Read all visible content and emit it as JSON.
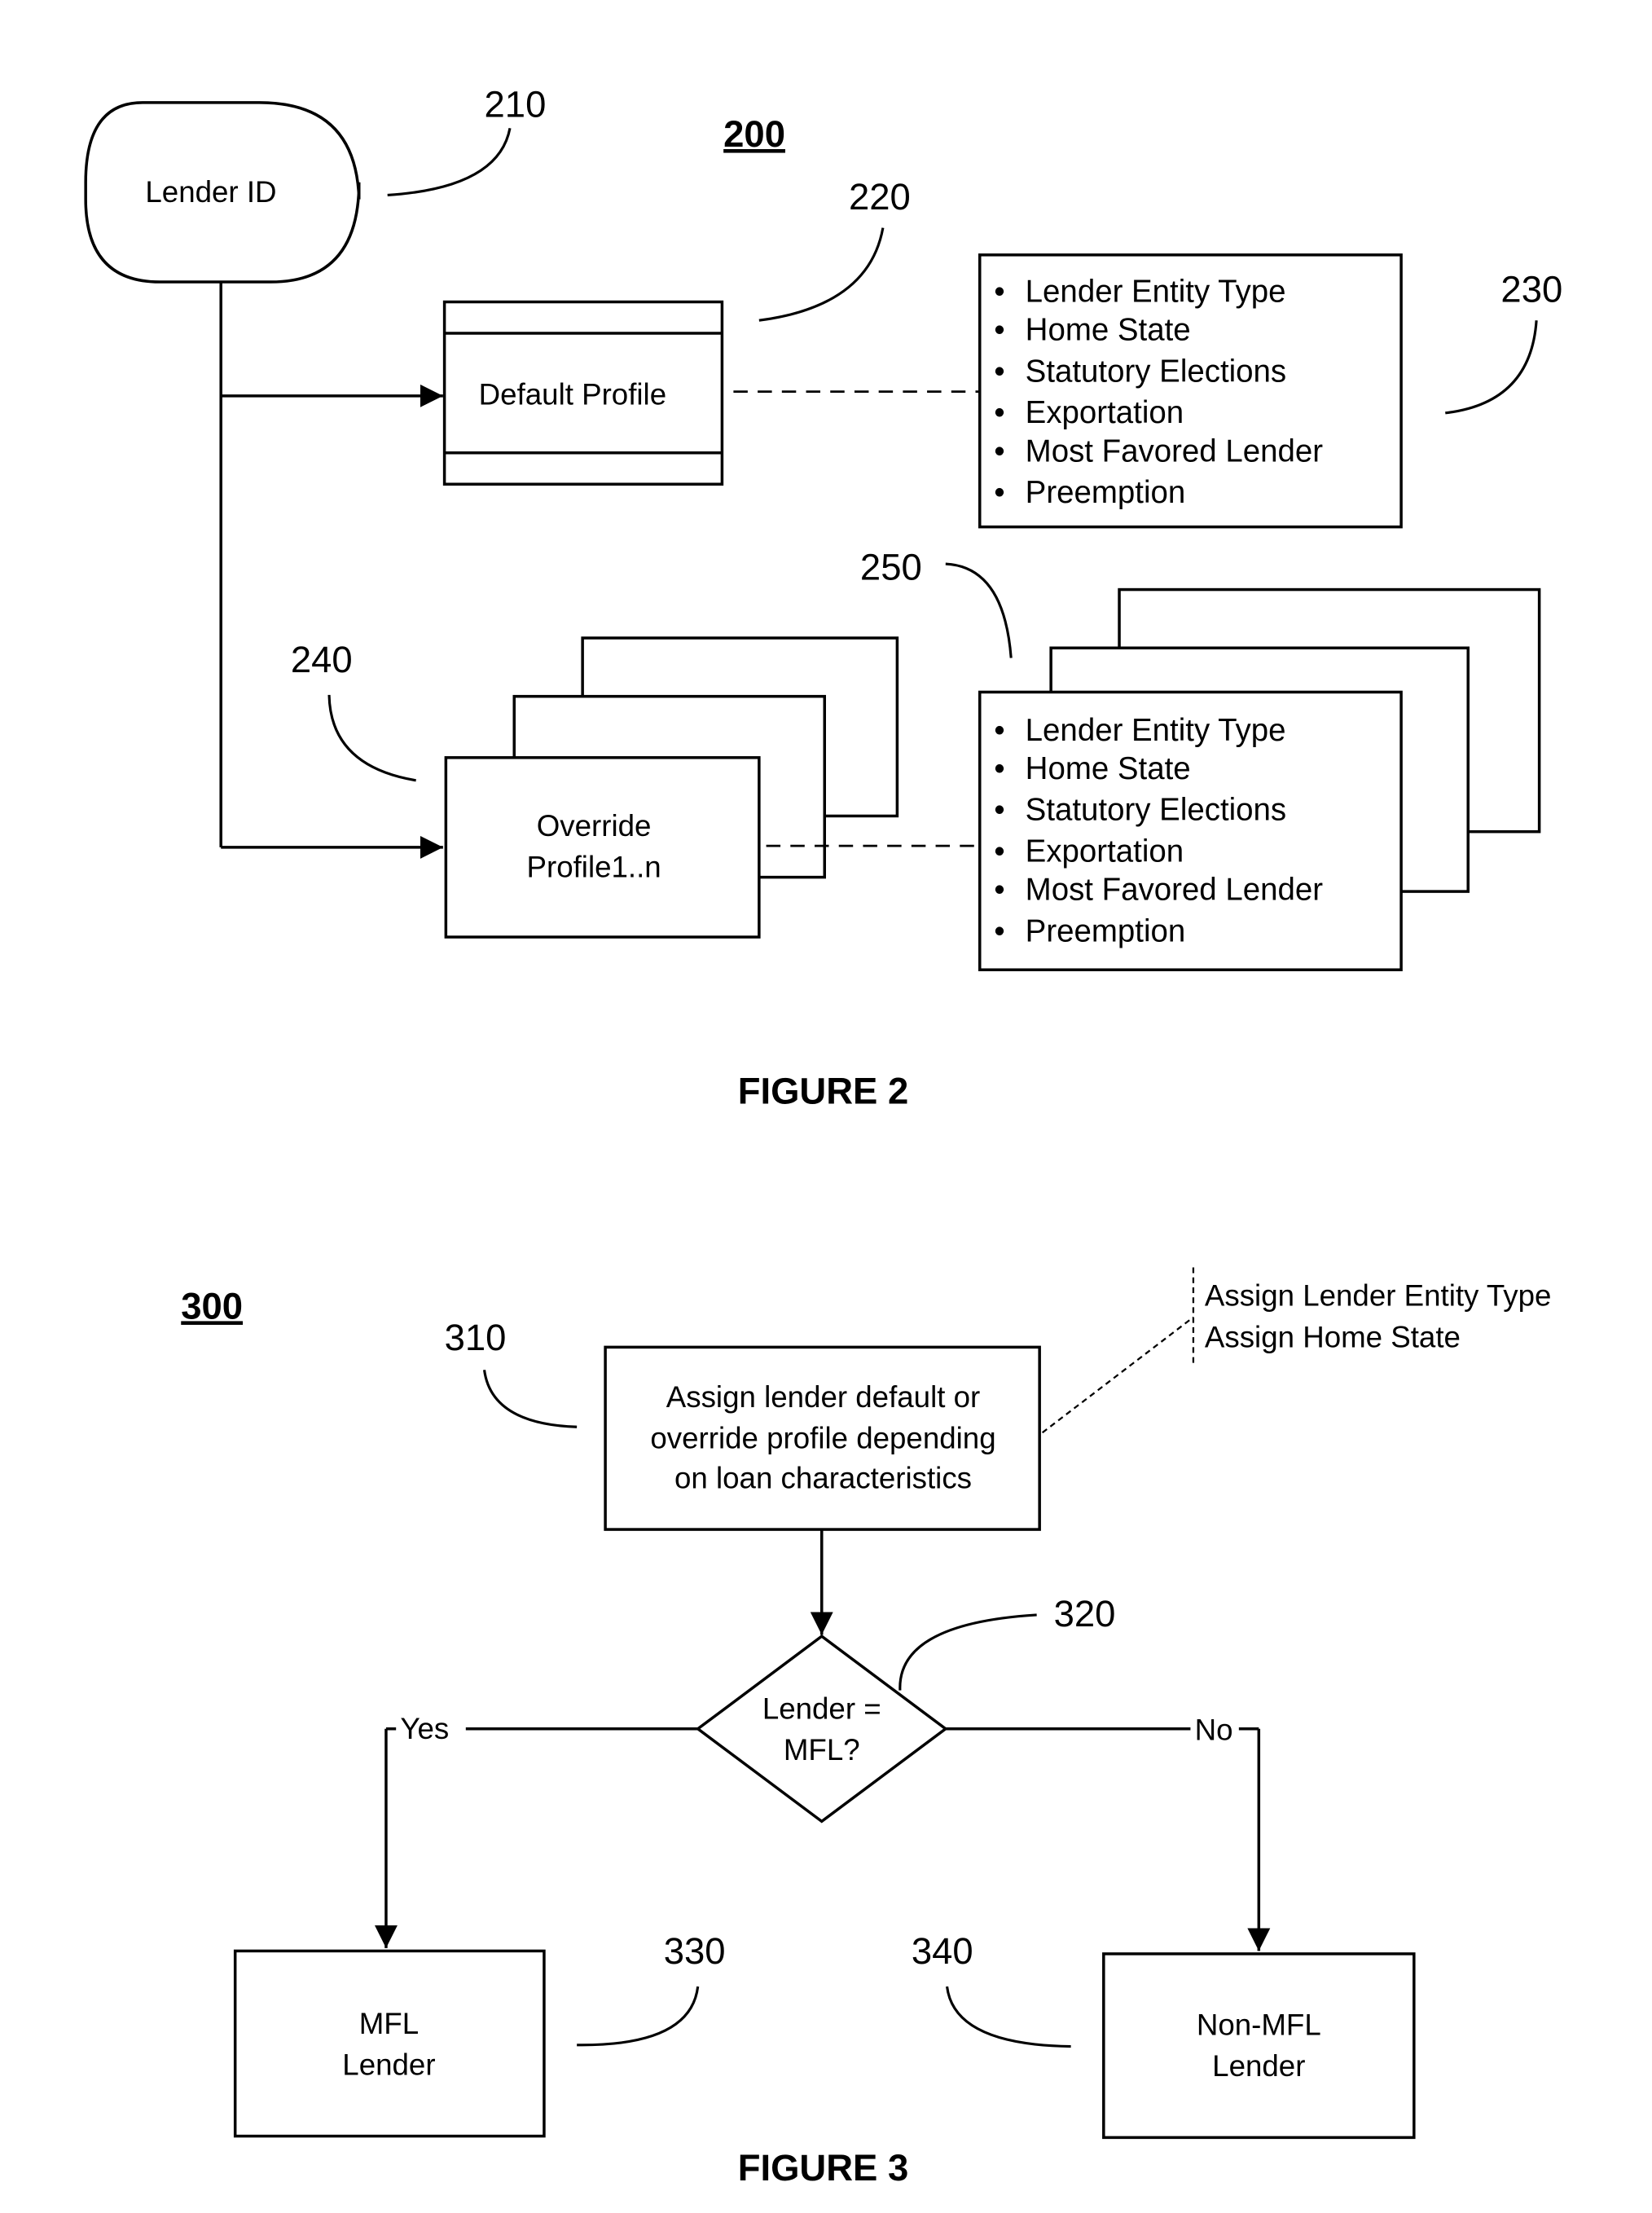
{
  "figure2": {
    "number": "200",
    "caption": "FIGURE 2",
    "lender_id": {
      "ref": "210",
      "label": "Lender ID"
    },
    "default_profile": {
      "ref": "220",
      "label": "Default Profile"
    },
    "default_attributes": {
      "ref": "230",
      "items": [
        "Lender Entity Type",
        "Home State",
        "Statutory Elections",
        "Exportation",
        "Most Favored Lender",
        "Preemption"
      ]
    },
    "override_profile": {
      "ref": "240",
      "label_line1": "Override",
      "label_line2": "Profile1..n"
    },
    "override_attributes": {
      "ref": "250",
      "items": [
        "Lender Entity Type",
        "Home State",
        "Statutory Elections",
        "Exportation",
        "Most Favored Lender",
        "Preemption"
      ]
    }
  },
  "figure3": {
    "number": "300",
    "caption": "FIGURE 3",
    "assign_step": {
      "ref": "310",
      "lines": [
        "Assign lender default or",
        "override profile depending",
        "on loan characteristics"
      ]
    },
    "annotation": [
      "Assign Lender Entity Type",
      "Assign Home State"
    ],
    "decision": {
      "ref": "320",
      "line1": "Lender =",
      "line2": "MFL?"
    },
    "yes_label": "Yes",
    "no_label": "No",
    "mfl_lender": {
      "ref": "330",
      "line1": "MFL",
      "line2": "Lender"
    },
    "non_mfl_lender": {
      "ref": "340",
      "line1": "Non-MFL",
      "line2": "Lender"
    }
  }
}
